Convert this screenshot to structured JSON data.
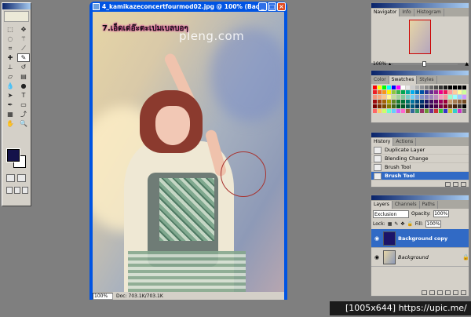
{
  "document": {
    "title": "4_kamikazeconcertfourmod02.jpg @ 100% (Back...",
    "overlay_text": "7.เอ็ดเด่อ๊ะตะเปมเบลบอๆ",
    "watermark": "pleng.com",
    "zoom": "100%",
    "doc_size": "Doc: 703.1K/703.1K"
  },
  "window_controls": {
    "minimize": "_",
    "maximize": "□",
    "close": "×"
  },
  "navigator": {
    "tabs": [
      "Navigator",
      "Info",
      "Histogram"
    ],
    "active_tab": "Navigator",
    "zoom": "100%",
    "zoom_level": 0.45
  },
  "swatches": {
    "tabs": [
      "Color",
      "Swatches",
      "Styles"
    ],
    "active_tab": "Swatches",
    "colors": [
      "#ff0000",
      "#ffff00",
      "#00ff00",
      "#00ffff",
      "#0000ff",
      "#ff00ff",
      "#ffffff",
      "#e6e6e6",
      "#cccccc",
      "#b3b3b3",
      "#999999",
      "#808080",
      "#666666",
      "#4d4d4d",
      "#333333",
      "#1a1a1a",
      "#000000",
      "#000000",
      "#000000",
      "#000000",
      "#ed1c24",
      "#f26522",
      "#f7941d",
      "#fff200",
      "#8dc63f",
      "#39b54a",
      "#00a651",
      "#00a99d",
      "#00aeef",
      "#0072bc",
      "#0054a6",
      "#2e3192",
      "#662d91",
      "#92278f",
      "#ec008c",
      "#ed145b",
      "#ff9999",
      "#ffcc99",
      "#ffff99",
      "#ccff99",
      "#f69679",
      "#f9ad81",
      "#fdc68a",
      "#fff79a",
      "#c4df9b",
      "#a3d39c",
      "#82ca9c",
      "#7accc8",
      "#6dcff6",
      "#7da7d9",
      "#8393ca",
      "#8781bd",
      "#a186be",
      "#bd8cbf",
      "#f49ac1",
      "#f5989d",
      "#99ffcc",
      "#99ffff",
      "#99ccff",
      "#cc99ff",
      "#9e0b0f",
      "#a0410d",
      "#a36209",
      "#aba000",
      "#598527",
      "#1a7b30",
      "#007236",
      "#00746b",
      "#0076a3",
      "#004b80",
      "#003471",
      "#1b1464",
      "#440e62",
      "#630460",
      "#9e005d",
      "#9e0039",
      "#c69c6d",
      "#a67c52",
      "#8c6239",
      "#754c24",
      "#790000",
      "#7b2e00",
      "#7d4900",
      "#827b00",
      "#406618",
      "#005e20",
      "#005826",
      "#005952",
      "#005b7f",
      "#003663",
      "#002157",
      "#0d004c",
      "#32004b",
      "#4b0049",
      "#7b0046",
      "#7a0026",
      "#603913",
      "#42210b",
      "#362f2d",
      "#000000",
      "#ff6666",
      "#ffcc66",
      "#ccff66",
      "#66ffcc",
      "#66ccff",
      "#cc66ff",
      "#ff66cc",
      "#996633",
      "#336699",
      "#339966",
      "#993366",
      "#669933",
      "#663399",
      "#cc3333",
      "#33cc33",
      "#3333cc",
      "#cccc33",
      "#33cccc",
      "#cc33cc",
      "#777777"
    ]
  },
  "history": {
    "tabs": [
      "History",
      "Actions"
    ],
    "active_tab": "History",
    "items": [
      "Duplicate Layer",
      "Blending Change",
      "Brush Tool",
      "Brush Tool"
    ],
    "selected_index": 3
  },
  "layers": {
    "tabs": [
      "Layers",
      "Channels",
      "Paths"
    ],
    "active_tab": "Layers",
    "blend_mode": "Exclusion",
    "opacity_label": "Opacity:",
    "opacity": "100%",
    "lock_label": "Lock:",
    "fill_label": "Fill:",
    "fill": "100%",
    "items": [
      {
        "name": "Background copy",
        "selected": true
      },
      {
        "name": "Background",
        "selected": false
      }
    ]
  },
  "tools": {
    "foreground_color": "#14124a",
    "background_color": "#ffffff",
    "icons": [
      "marquee-icon",
      "move-icon",
      "lasso-icon",
      "magic-wand-icon",
      "crop-icon",
      "slice-icon",
      "healing-icon",
      "brush-icon",
      "stamp-icon",
      "history-brush-icon",
      "eraser-icon",
      "gradient-icon",
      "blur-icon",
      "dodge-icon",
      "path-select-icon",
      "type-icon",
      "pen-icon",
      "shape-icon",
      "notes-icon",
      "eyedropper-icon",
      "hand-icon",
      "zoom-icon"
    ],
    "active_tool": "brush-icon"
  },
  "footer": {
    "text": "[1005x644] https://upic.me/"
  }
}
